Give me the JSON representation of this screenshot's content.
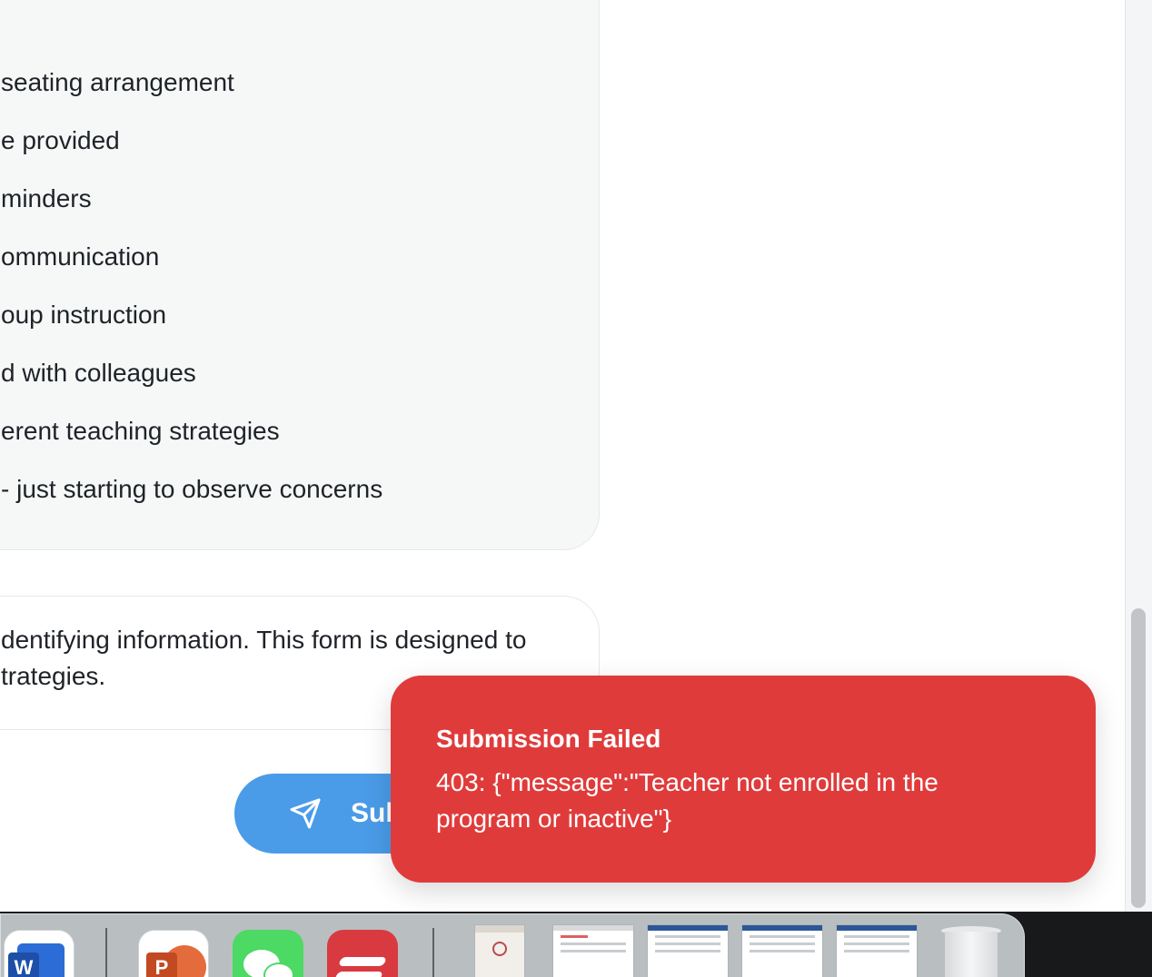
{
  "summary": {
    "lines": [
      " seating arrangement",
      "e provided",
      "minders",
      "ommunication",
      "oup instruction",
      "d with colleagues",
      "erent teaching strategies",
      " - just starting to observe concerns"
    ]
  },
  "notice": {
    "line1": "dentifying information. This form is designed to",
    "line2": "trategies."
  },
  "submit": {
    "label": "Sub",
    "icon": "send-icon"
  },
  "toast": {
    "title": "Submission Failed",
    "message": "403: {\"message\":\"Teacher not enrolled in the program or inactive\"}",
    "color": "#e03b3b"
  },
  "dock": {
    "apps": [
      "word-icon",
      "powerpoint-icon",
      "wechat-icon",
      "expressvpn-icon",
      "trash-icon"
    ],
    "word_letter": "W",
    "powerpoint_letter": "P"
  },
  "colors": {
    "accent": "#4a9be8",
    "error": "#e03b3b",
    "card_bg": "#f6f8f8"
  }
}
